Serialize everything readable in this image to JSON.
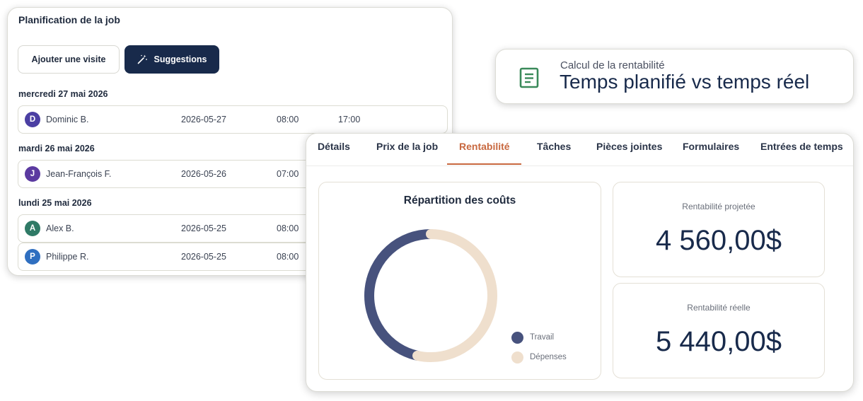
{
  "planning": {
    "title": "Planification de la job",
    "add_visit_label": "Ajouter une visite",
    "suggestions_label": "Suggestions",
    "groups": [
      {
        "day": "mercredi 27 mai 2026",
        "rows": [
          {
            "initial": "D",
            "name": "Dominic B.",
            "date": "2026-05-27",
            "start": "08:00",
            "end": "17:00",
            "color": "#4b3fa3"
          }
        ]
      },
      {
        "day": "mardi 26 mai 2026",
        "rows": [
          {
            "initial": "J",
            "name": "Jean-François F.",
            "date": "2026-05-26",
            "start": "07:00",
            "end": "",
            "color": "#5b3aa0"
          }
        ]
      },
      {
        "day": "lundi 25 mai 2026",
        "rows": [
          {
            "initial": "A",
            "name": "Alex B.",
            "date": "2026-05-25",
            "start": "08:00",
            "end": "",
            "color": "#2f7a66"
          },
          {
            "initial": "P",
            "name": "Philippe R.",
            "date": "2026-05-25",
            "start": "08:00",
            "end": "",
            "color": "#2f6fc0"
          }
        ]
      }
    ]
  },
  "callout": {
    "subtitle": "Calcul de la rentabilité",
    "title": "Temps planifié vs temps réel",
    "icon": "document-icon",
    "icon_color": "#3a8a5a"
  },
  "tabs": [
    {
      "label": "Détails",
      "active": false
    },
    {
      "label": "Prix de la job",
      "active": false
    },
    {
      "label": "Rentabilité",
      "active": true
    },
    {
      "label": "Tâches",
      "active": false
    },
    {
      "label": "Pièces jointes",
      "active": false
    },
    {
      "label": "Formulaires",
      "active": false
    },
    {
      "label": "Entrées de temps",
      "active": false
    }
  ],
  "chart_data": {
    "type": "pie",
    "title": "Répartition des coûts",
    "series": [
      {
        "name": "Travail",
        "value": 0.465,
        "color": "#47527d"
      },
      {
        "name": "Dépenses",
        "value": 0.535,
        "color": "#efdfcd"
      }
    ],
    "legend_position": "bottom-right"
  },
  "kpis": {
    "projected": {
      "label": "Rentabilité projetée",
      "value": "4 560,00$"
    },
    "actual": {
      "label": "Rentabilité réelle",
      "value": "5 440,00$"
    }
  },
  "colors": {
    "accent": "#c8683f",
    "primary_dark": "#182a4b"
  }
}
